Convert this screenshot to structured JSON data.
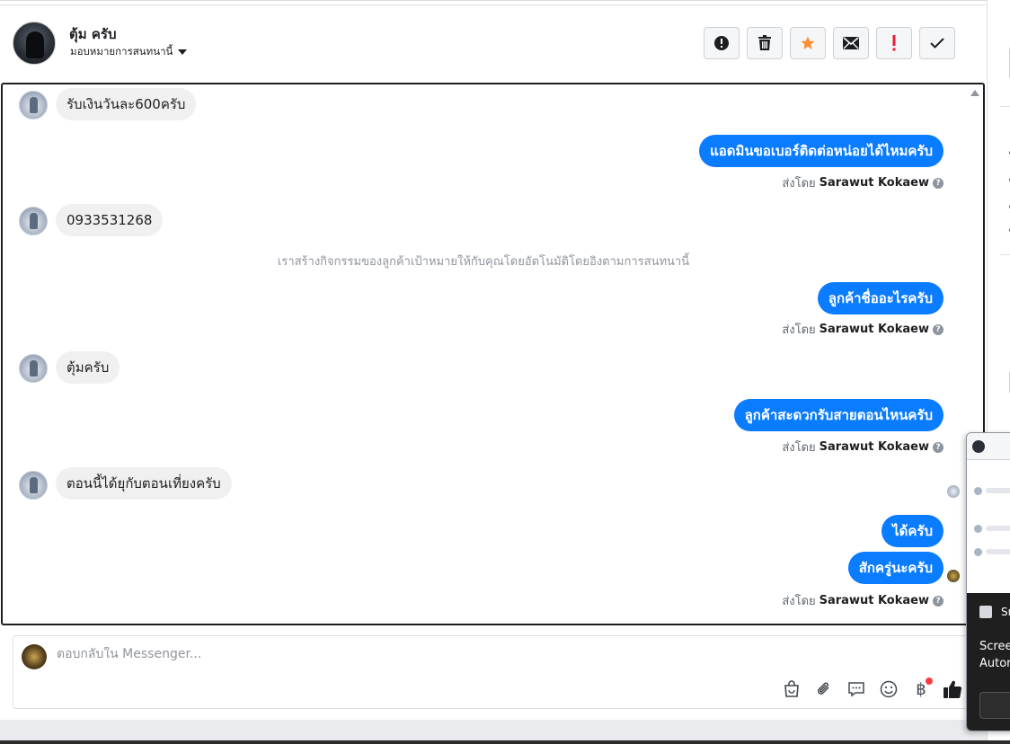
{
  "header": {
    "contact_name": "ตุ้ม ครับ",
    "assign_label": "มอบหมายการสนทนานี้"
  },
  "actions": [
    {
      "name": "spam-report",
      "icon": "alert-circle-icon"
    },
    {
      "name": "delete",
      "icon": "trash-icon"
    },
    {
      "name": "star",
      "icon": "star-icon",
      "color": "#f7923b"
    },
    {
      "name": "mark-unread",
      "icon": "envelope-icon"
    },
    {
      "name": "follow-up",
      "icon": "exclamation-icon",
      "color": "#e41e3f"
    },
    {
      "name": "mark-done",
      "icon": "check-icon"
    }
  ],
  "messages": {
    "m1": "รับเงินวันละ600ครับ",
    "m2": "แอดมินขอเบอร์ติดต่อหน่อยได้ไหมครับ",
    "m3": "0933531268",
    "system_note": "เราสร้างกิจกรรมของลูกค้าเป้าหมายให้กับคุณโดยอัตโนมัติโดยอิงตามการสนทนานี้",
    "m4": "ลูกค้าชื่ออะไรครับ",
    "m5": "ตุ้มครับ",
    "m6": "ลูกค้าสะดวกรับสายตอนไหนครับ",
    "m7": "ตอนนี้ได้ยุกับตอนเที่ยงครับ",
    "m8": "ได้ครับ",
    "m9": "สักครู่นะครับ"
  },
  "sent_by": {
    "prefix": "ส่งโดย",
    "name": "Sarawut Kokaew"
  },
  "composer": {
    "placeholder": "ตอบกลับใน Messenger..."
  },
  "popup": {
    "title": "Sn",
    "line1": "Scree",
    "line2": "Autor"
  },
  "colors": {
    "outgoing_bubble": "#0a7cff",
    "incoming_bubble": "#f1f0f0",
    "accent_star": "#f7923b",
    "alert_red": "#e41e3f"
  }
}
